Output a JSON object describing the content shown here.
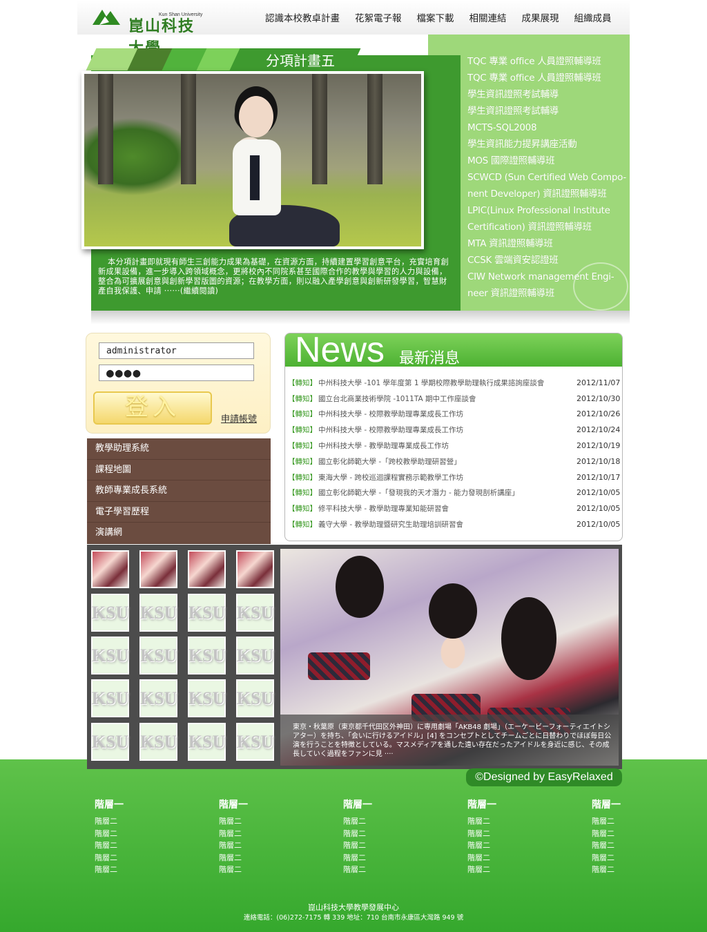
{
  "header": {
    "logo_en": "Kun Shan University",
    "logo_cn": "崑山科技大學",
    "nav": [
      "認識本校教卓計畫",
      "花絮電子報",
      "檔案下載",
      "相關連結",
      "成果展現",
      "組織成員"
    ]
  },
  "hero": {
    "tab_title": "分項計畫五",
    "description": "本分項計畫即就現有師生三創能力成果為基礎，在資源方面，持續建置學習創意平台，充實培育創新成果設備，進一步導入跨領域概念，更將校內不同院系甚至國際合作的教學與學習的人力與設備，整合為可擴展創意與創新學習版圖的資源；在教學方面，則以融入產學創意與創新研發學習，智慧財產自我保護、申請 ‧‧‧‧‧‧(繼續閱讀)",
    "list": [
      "TQC 專業 office 人員證照輔導班",
      "TQC 專業 office 人員證照輔導班",
      "學生資訊證照考試輔導",
      "學生資訊證照考試輔導",
      "MCTS-SQL2008",
      "學生資訊能力提昇講座活動",
      "MOS 國際證照輔導班",
      "SCWCD (Sun Certified Web Compo-",
      "nent Developer) 資訊證照輔導班",
      "LPIC(Linux Professional Institute",
      "Certification) 資訊證照輔導班",
      "MTA 資訊證照輔導班",
      "CCSK 雲端資安認證班",
      "CIW Network management Engi-",
      "neer 資訊證照輔導班"
    ]
  },
  "login": {
    "username_value": "administrator",
    "password_value": "●●●●",
    "login_label": "登入",
    "apply_label": "申請帳號"
  },
  "side_menu": [
    "教學助理系統",
    "課程地圖",
    "教師專業成長系統",
    "電子學習歷程",
    "演講網"
  ],
  "news": {
    "title_en": "News",
    "title_cn": "最新消息",
    "items": [
      {
        "tag": "【轉知】",
        "title": "中州科技大學 -101 學年度第 1 學期校際教學助理執行成果諮詢座談會",
        "date": "2012/11/07"
      },
      {
        "tag": "【轉知】",
        "title": "國立台北商業技術學院 -1011TA 期中工作座談會",
        "date": "2012/10/30"
      },
      {
        "tag": "【轉知】",
        "title": "中州科技大學 - 校際教學助理專業成長工作坊",
        "date": "2012/10/26"
      },
      {
        "tag": "【轉知】",
        "title": "中州科技大學 - 校際教學助理專業成長工作坊",
        "date": "2012/10/24"
      },
      {
        "tag": "【轉知】",
        "title": "中州科技大學 - 教學助理專業成長工作坊",
        "date": "2012/10/19"
      },
      {
        "tag": "【轉知】",
        "title": "國立彰化師範大學 -「跨校教學助理研習營」",
        "date": "2012/10/18"
      },
      {
        "tag": "【轉知】",
        "title": "東海大學 - 跨校巡迴課程實務示範教學工作坊",
        "date": "2012/10/17"
      },
      {
        "tag": "【轉知】",
        "title": "國立彰化師範大學 -「發現我的天才潛力 - 能力發現剖析講座」",
        "date": "2012/10/05"
      },
      {
        "tag": "【轉知】",
        "title": "修平科技大學 - 教學助理專業知能研習會",
        "date": "2012/10/05"
      },
      {
        "tag": "【轉知】",
        "title": "義守大學 - 教學助理暨研究生助理培訓研習會",
        "date": "2012/10/05"
      }
    ]
  },
  "gallery": {
    "thumb_placeholder": "KSU",
    "caption": "東京・秋葉原（東京都千代田区外神田）に専用劇場「AKB48 劇場」（エーケービーフォーティエイトシアター）を持ち、「会いに行けるアイドル」[4] をコンセプトとしてチームごとに日替わりでほぼ毎日公演を行うことを特徴としている。マスメディアを通した遠い存在だったアイドルを身近に感じ、その成長していく過程をファンに見 ‧‧‧‧"
  },
  "designed_by": "©Designed by EasyRelaxed",
  "footer": {
    "columns": [
      {
        "heading": "階層一",
        "items": [
          "階層二",
          "階層二",
          "階層二",
          "階層二",
          "階層二"
        ]
      },
      {
        "heading": "階層一",
        "items": [
          "階層二",
          "階層二",
          "階層二",
          "階層二",
          "階層二"
        ]
      },
      {
        "heading": "階層一",
        "items": [
          "階層二",
          "階層二",
          "階層二",
          "階層二",
          "階層二"
        ]
      },
      {
        "heading": "階層一",
        "items": [
          "階層二",
          "階層二",
          "階層二",
          "階層二",
          "階層二"
        ]
      },
      {
        "heading": "階層一",
        "items": [
          "階層二",
          "階層二",
          "階層二",
          "階層二",
          "階層二"
        ]
      }
    ],
    "org": "崑山科技大學教學發展中心",
    "contact": "連絡電話：(06)272-7175 轉 339 地址：710 台南市永康區大灣路 949 號"
  },
  "colors": {
    "brand_green": "#3e9a2f",
    "light_green": "#9ed87a",
    "menu_brown": "#6b4c40",
    "footer_green": "#35a82d"
  }
}
